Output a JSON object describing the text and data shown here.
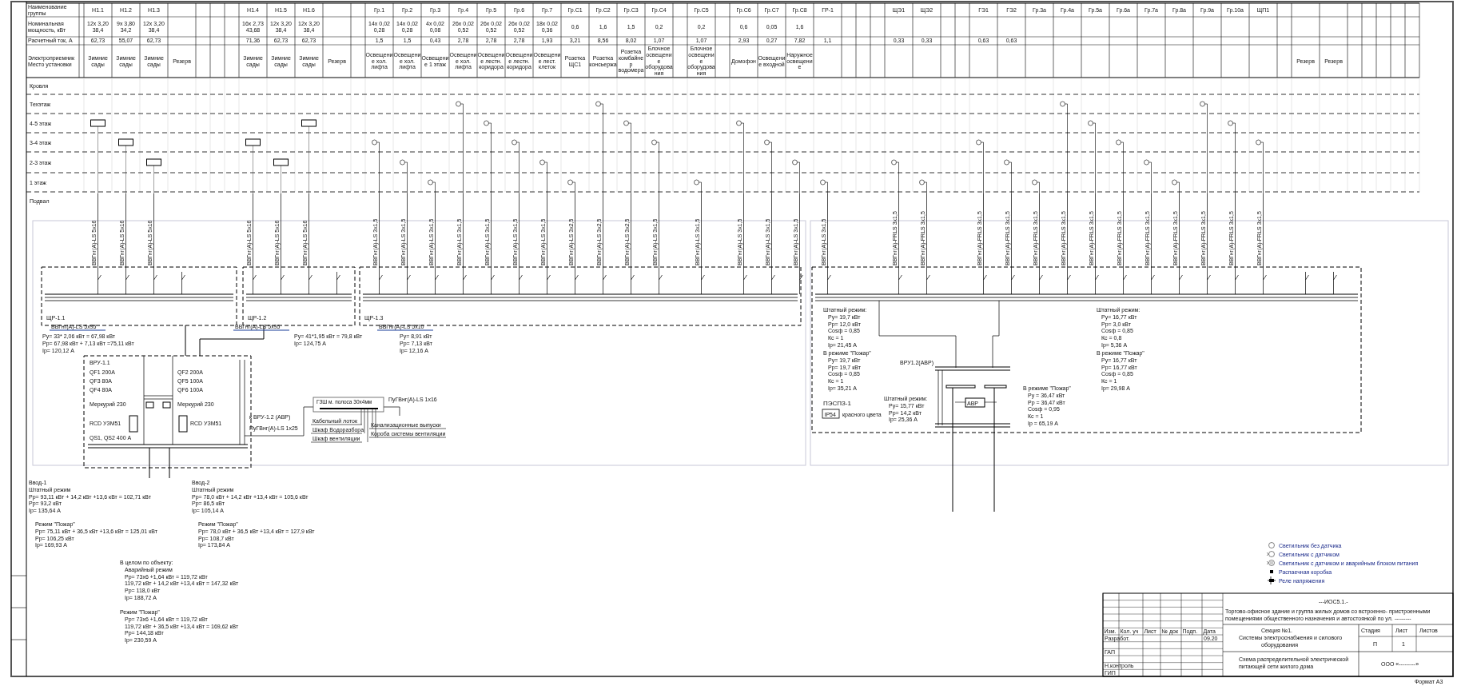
{
  "sheet": {
    "header_labels": [
      "Наименование группы",
      "Номинальная мощность, кВт",
      "Расчетный ток, А",
      "Электроприемник Место установки"
    ],
    "zones": [
      "Кровля",
      "Техэтаж",
      "4-5 этаж",
      "3-4 этаж",
      "2-3 этаж",
      "1 этаж",
      "Подвал"
    ],
    "columns": [
      {
        "kind": "heater",
        "name": "Н1.1",
        "power": "12х 3,20",
        "total": "38,4",
        "current": "62,73",
        "consumer": "Зимние сады",
        "cable": "ВВГнг(А)-LS 5х16"
      },
      {
        "kind": "heater",
        "name": "Н1.2",
        "power": "9х 3,80",
        "total": "34,2",
        "current": "55,07",
        "consumer": "Зимние сады",
        "cable": "ВВГнг(А)-LS 5х16"
      },
      {
        "kind": "heater",
        "name": "Н1.3",
        "power": "12х 3,20",
        "total": "38,4",
        "current": "62,73",
        "consumer": "Зимние сады",
        "cable": "ВВГнг(А)-LS 5х16"
      },
      {
        "kind": "reserve",
        "consumer": "Резерв"
      },
      {
        "kind": "blank"
      },
      {
        "kind": "blank"
      },
      {
        "kind": "blank"
      },
      {
        "kind": "heater",
        "name": "Н1.4",
        "power": "16х 2,73",
        "total": "43,68",
        "current": "71,36",
        "consumer": "Зимние сады",
        "cable": "ВВГнг(А)-LS 5х16"
      },
      {
        "kind": "heater",
        "name": "Н1.5",
        "power": "12х 3,20",
        "total": "38,4",
        "current": "62,73",
        "consumer": "Зимние сады",
        "cable": "ВВГнг(А)-LS 5х16"
      },
      {
        "kind": "heater",
        "name": "Н1.6",
        "power": "12х 3,20",
        "total": "38,4",
        "current": "62,73",
        "consumer": "Зимние сады",
        "cable": "ВВГнг(А)-LS 5х16"
      },
      {
        "kind": "reserve",
        "consumer": "Резерв"
      },
      {
        "kind": "blank"
      },
      {
        "kind": "group",
        "name": "Гр.1",
        "power": "14х 0,02",
        "total": "0,28",
        "current": "1,5",
        "consumer": "Освещение хол. лифта",
        "cable": "ВВГнг(А)-LS 3х1,5"
      },
      {
        "kind": "group",
        "name": "Гр.2",
        "power": "14х 0,02",
        "total": "0,28",
        "current": "1,5",
        "consumer": "Освещение хол. лифта",
        "cable": "ВВГнг(А)-LS 3х1,5"
      },
      {
        "kind": "group",
        "name": "Гр.3",
        "power": "4х 0,02",
        "total": "0,08",
        "current": "0,43",
        "consumer": "Освещение 1 этаж",
        "cable": "ВВГнг(А)-LS 3х1,5"
      },
      {
        "kind": "group",
        "name": "Гр.4",
        "power": "26х 0,02",
        "total": "0,52",
        "current": "2,78",
        "consumer": "Освещение хол. лифта",
        "cable": "ВВГнг(А)-LS 3х1,5"
      },
      {
        "kind": "group",
        "name": "Гр.5",
        "power": "26х 0,02",
        "total": "0,52",
        "current": "2,78",
        "consumer": "Освещение лестн. коридора",
        "cable": "ВВГнг(А)-LS 3х1,5"
      },
      {
        "kind": "group",
        "name": "Гр.6",
        "power": "26х 0,02",
        "total": "0,52",
        "current": "2,78",
        "consumer": "Освещение лестн. коридора",
        "cable": "ВВГнг(А)-LS 3х1,5"
      },
      {
        "kind": "group",
        "name": "Гр.7",
        "power": "18х 0,02",
        "total": "0,36",
        "current": "1,93",
        "consumer": "Освещение лест. клеток",
        "cable": "ВВГнг(А)-LS 3х1,5"
      },
      {
        "kind": "group",
        "name": "Гр.С1",
        "power": "0,6",
        "current": "3,21",
        "consumer": "Розетка ЩС1",
        "cable": "ВВГнг(А)-LS 3х2,5"
      },
      {
        "kind": "group",
        "name": "Гр.С2",
        "power": "1,6",
        "current": "8,56",
        "consumer": "Розетка консьержа",
        "cable": "ВВГнг(А)-LS 3х2,5"
      },
      {
        "kind": "group",
        "name": "Гр.С3",
        "power": "1,5",
        "current": "8,02",
        "consumer": "Розетка комбайнер водомера",
        "cable": "ВВГнг(А)-LS 3х2,5"
      },
      {
        "kind": "group",
        "name": "Гр.С4",
        "power": "0,2",
        "current": "1,07",
        "consumer": "Блочное освещение оборудования",
        "cable": "ВВГнг(А)-LS 3х1,5"
      },
      {
        "kind": "blank"
      },
      {
        "kind": "group",
        "name": "Гр.С5",
        "power": "0,2",
        "current": "1,07",
        "consumer": "Блочное освещение оборудования",
        "cable": "ВВГнг(А)-LS 3х1,5"
      },
      {
        "kind": "blank"
      },
      {
        "kind": "group",
        "name": "Гр.С6",
        "power": "0,6",
        "current": "2,93",
        "consumer": "Домофон",
        "cable": "ВВГнг(А)-LS 3х1,5"
      },
      {
        "kind": "group",
        "name": "Гр.С7",
        "power": "0,05",
        "current": "0,27",
        "consumer": "Освещение входной",
        "cable": "ВВГнг(А)-LS 3х1,5"
      },
      {
        "kind": "group",
        "name": "Гр.С8",
        "power": "1,6",
        "current": "7,82",
        "consumer": "Наружное освещение",
        "cable": "ВВГнг(А)-LS 3х1,5"
      },
      {
        "kind": "group",
        "name": "ГР-1",
        "current": "1,1",
        "cable": "ВВГнг(А)-LS 3х1,5"
      },
      {
        "kind": "blank"
      },
      {
        "kind": "blank"
      },
      {
        "kind": "blank"
      },
      {
        "kind": "group",
        "name": "ЩЭ1",
        "current": "0,33",
        "cable": "ВВГнг(А)-FRLS 3х1,5"
      },
      {
        "kind": "group",
        "name": "ЩЭ2",
        "current": "0,33",
        "cable": "ВВГнг(А)-FRLS 3х1,5"
      },
      {
        "kind": "blank"
      },
      {
        "kind": "blank"
      },
      {
        "kind": "group",
        "name": "ГЭ1",
        "current": "0,63",
        "cable": "ВВГнг(А)-FRLS 3х1,5"
      },
      {
        "kind": "group",
        "name": "ГЭ2",
        "current": "0,63",
        "cable": "ВВГнг(А)-FRLS 3х1,5"
      },
      {
        "kind": "group",
        "name": "Гр.3а",
        "cable": "ВВГнг(А)-FRLS 3х1,5"
      },
      {
        "kind": "group",
        "name": "Гр.4а",
        "cable": "ВВГнг(А)-FRLS 3х1,5"
      },
      {
        "kind": "group",
        "name": "Гр.5а",
        "cable": "ВВГнг(А)-FRLS 3х1,5"
      },
      {
        "kind": "group",
        "name": "Гр.6а",
        "cable": "ВВГнг(А)-FRLS 3х1,5"
      },
      {
        "kind": "group",
        "name": "Гр.7а",
        "cable": "ВВГнг(А)-FRLS 3х1,5"
      },
      {
        "kind": "group",
        "name": "Гр.8а",
        "cable": "ВВГнг(А)-FRLS 3х1,5"
      },
      {
        "kind": "group",
        "name": "Гр.9а",
        "cable": "ВВГнг(А)-FRLS 3х1,5"
      },
      {
        "kind": "group",
        "name": "Гр.10а",
        "cable": "ВВГнг(А)-FRLS 3х1,5"
      },
      {
        "kind": "group",
        "name": "ЩП1",
        "cable": "ВВГнг(А)-FRLS 3х1,5"
      },
      {
        "kind": "blank"
      },
      {
        "kind": "reserve",
        "consumer": "Резерв"
      },
      {
        "kind": "reserve",
        "consumer": "Резерв"
      },
      {
        "kind": "blank"
      },
      {
        "kind": "blank"
      },
      {
        "kind": "blank"
      },
      {
        "kind": "blank"
      },
      {
        "kind": "blank"
      }
    ]
  },
  "panels": [
    {
      "label": "ЩР-1.1"
    },
    {
      "label": "ЩР-1.2"
    },
    {
      "label": "ЩР-1.3"
    }
  ],
  "feeders": [
    {
      "cable": "ВВГнг(А)-LS 5х95",
      "lines": [
        "Ру= 33* 2,06 кВт = 67,98 кВт",
        "Рр= 67,98 кВт + 7,13 кВт =75,11 кВт",
        "Iр= 120,12 А"
      ]
    },
    {
      "cable": "ВВГнг(А)-LS 5х95",
      "lines": [
        "Ру= 41*1,95 кВт = 79,8 кВт",
        "Iр= 124,75 А"
      ]
    },
    {
      "cable": "ВВГнг(А)-LS 5х10",
      "lines": [
        "Ру= 8,91 кВт",
        "Рр= 7,13 кВт",
        "Iр= 12,16 А"
      ]
    }
  ],
  "vru": {
    "title": "ВРУ-1.1",
    "labels": [
      "QF1 200А",
      "QF2 200А",
      "QF3 80А",
      "QF4 80А",
      "QF5 100А",
      "QF6 100А",
      "Меркурий 230",
      "Меркурий 230",
      "RCD УЗМ51",
      "RCD УЗМ51",
      "QS1, QS2 400 А"
    ],
    "feed": "к ВРУ-1.2 (АВР)",
    "feed_cable": "ПуГВнг(А)-LS 1х25"
  },
  "grounding": {
    "title": "ГЗШ м. полоса 30х4мм",
    "labels": [
      "Кабельный лоток",
      "Шкаф Водоразбора",
      "Шкаф вентиляции",
      "Канализационные выпуски",
      "Короба системы вентиляции"
    ],
    "cable": "ПуГВнг(А)-LS 1х16"
  },
  "notes": [
    {
      "lines": [
        "Ввод-1",
        "Штатный режим",
        "Рр= 93,11 кВт + 14,2 кВт +13,6 кВт = 102,71 кВт",
        "Рр= 93,2 кВт",
        "Iр= 135,64 А"
      ]
    },
    {
      "lines": [
        "Режим \"Пожар\"",
        "Рр= 75,11 кВт + 36,5 кВт +13,6 кВт = 125,01 кВт",
        "Рр= 106,25 кВт",
        "Iр= 169,93 А"
      ]
    },
    {
      "lines": [
        "Ввод-2",
        "Штатный режим",
        "Рр= 78,0 кВт + 14,2 кВт +13,4 кВт = 105,6 кВт",
        "Рр= 86,5 кВт",
        "Iр= 105,14 А"
      ]
    },
    {
      "lines": [
        "Режим \"Пожар\"",
        "Рр= 78,0 кВт + 36,5 кВт +13,4 кВт = 127,9 кВт",
        "Рр= 108,7 кВт",
        "Iр= 173,84 А"
      ]
    },
    {
      "lines": [
        "В целом по объекту:",
        "Аварийный режим",
        "Рр= 73х6 +1,64 кВт = 119,72 кВт",
        "119,72 кВт + 14,2 кВт +13,4 кВт = 147,32 кВт",
        "Рр= 118,0 кВт",
        "Iр= 188,72 А"
      ]
    },
    {
      "lines": [
        "Режим \"Пожар\"",
        "Рр= 73х6 +1,64 кВт = 119,72 кВт",
        "119,72 кВт + 36,5 кВт +13,4 кВт = 169,62 кВт",
        "Рр= 144,18 кВт",
        "Iр= 230,59 А"
      ]
    }
  ],
  "fire_panel": {
    "title": "ПЭСПЗ-1",
    "badge": "IP54",
    "caption": "красного цвета",
    "avr_title": "ВРУ1.2(АВР)",
    "avr_device": "АВР",
    "blocks": [
      {
        "lines": [
          "Штатный режим:",
          "Ру= 19,7 кВт",
          "Рр= 12,0 кВт",
          "Cosф = 0,85",
          "Кс = 1",
          "Iр= 21,45 А"
        ]
      },
      {
        "lines": [
          "В режиме \"Пожар\"",
          "Ру= 19,7 кВт",
          "Рр= 19,7 кВт",
          "Cosф = 0,85",
          "Кс = 1",
          "Iр= 35,21 А"
        ]
      },
      {
        "lines": [
          "Штатный режим:",
          "Ру= 15,77 кВт",
          "Рр= 14,2 кВт",
          "Iр= 25,36 А"
        ]
      },
      {
        "lines": [
          "В режиме \"Пожар\"",
          "Ру = 36,47 кВт",
          "Рр = 36,47 кВт",
          "Cosф = 0,95",
          "Кс = 1",
          "Iр = 65,19 А"
        ]
      },
      {
        "lines": [
          "Штатный режим:",
          "Ру= 16,77 кВт",
          "Рр= 3,0 кВт",
          "Cosф = 0,85",
          "Кс = 0,8",
          "Iр= 5,36 А"
        ]
      },
      {
        "lines": [
          "В режиме \"Пожар\"",
          "Ру= 16,77 кВт",
          "Рр= 16,77 кВт",
          "Cosф = 0,85",
          "Кс = 1",
          "Iр= 29,98 А"
        ]
      }
    ]
  },
  "legend": [
    {
      "kind": "lamp",
      "text": "Светильник без датчика"
    },
    {
      "kind": "lamp_sensor",
      "text": "Светильник с датчиком"
    },
    {
      "kind": "lamp_sensor_battery",
      "text": "Светильник с датчиком и аварийным блоком питания"
    },
    {
      "kind": "box",
      "text": "Распаечная коробка"
    },
    {
      "kind": "relay",
      "text": "Реле напряжения"
    }
  ],
  "title_block": {
    "code": "---ИОС5.1.-",
    "project": [
      "Торгово-офисное здание и группа жилых домов со встроенно- пристроенными",
      "помещениями общественного назначения и автостоянкой по ул. ---------"
    ],
    "headers": [
      "Изм.",
      "Кол. уч",
      "Лист",
      "№ док",
      "Подп.",
      "Дата"
    ],
    "roles": [
      "Разработ.",
      "ГАП",
      "Н.контроль",
      "ГИП"
    ],
    "date": "09.20",
    "section": [
      "Секция №1.",
      "Системы электроснабжения и силового",
      "оборудования"
    ],
    "sheet_headers": [
      "Стадия",
      "Лист",
      "Листов"
    ],
    "stage": "П",
    "sheet": "1",
    "drawing": [
      "Схема распределительной электрической",
      "питающей сети жилого дома"
    ],
    "company": "ООО «---------»",
    "format": "Формат А3"
  }
}
